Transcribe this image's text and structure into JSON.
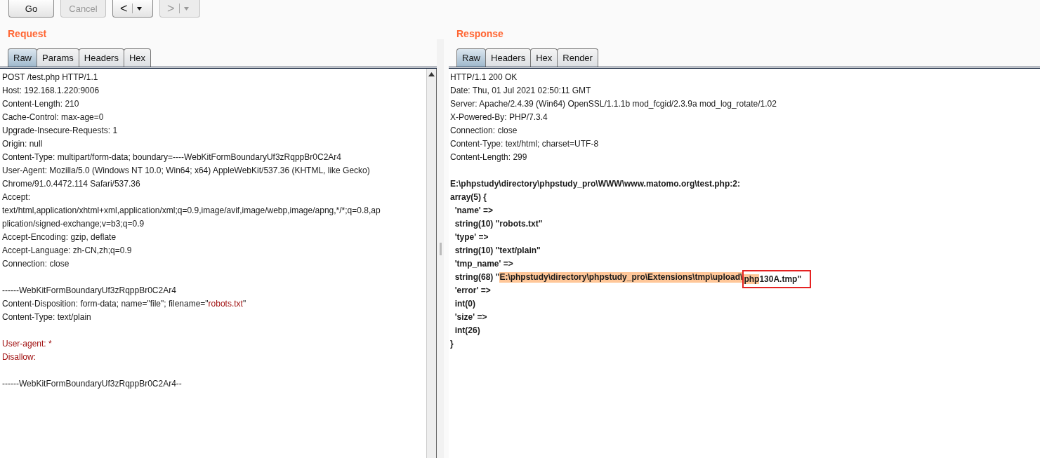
{
  "toolbar": {
    "buttons": [
      {
        "kind": "text",
        "label": "Go",
        "disabled": false
      },
      {
        "kind": "text",
        "label": "Cancel",
        "disabled": true
      },
      {
        "kind": "back",
        "label": "<",
        "disabled": false
      },
      {
        "kind": "forward",
        "label": ">",
        "disabled": true
      }
    ]
  },
  "request": {
    "title": "Request",
    "tabs": [
      {
        "label": "Raw",
        "selected": true
      },
      {
        "label": "Params",
        "selected": false
      },
      {
        "label": "Headers",
        "selected": false
      },
      {
        "label": "Hex",
        "selected": false
      }
    ],
    "lines": [
      {
        "kind": "plain",
        "text": "POST /test.php HTTP/1.1"
      },
      {
        "kind": "plain",
        "text": "Host: 192.168.1.220:9006"
      },
      {
        "kind": "plain",
        "text": "Content-Length: 210"
      },
      {
        "kind": "plain",
        "text": "Cache-Control: max-age=0"
      },
      {
        "kind": "plain",
        "text": "Upgrade-Insecure-Requests: 1"
      },
      {
        "kind": "plain",
        "text": "Origin: null"
      },
      {
        "kind": "plain",
        "text": "Content-Type: multipart/form-data; boundary=----WebKitFormBoundaryUf3zRqppBr0C2Ar4"
      },
      {
        "kind": "plain",
        "text": "User-Agent: Mozilla/5.0 (Windows NT 10.0; Win64; x64) AppleWebKit/537.36 (KHTML, like Gecko)"
      },
      {
        "kind": "plain",
        "text": "Chrome/91.0.4472.114 Safari/537.36"
      },
      {
        "kind": "plain",
        "text": "Accept:"
      },
      {
        "kind": "plain",
        "text": "text/html,application/xhtml+xml,application/xml;q=0.9,image/avif,image/webp,image/apng,*/*;q=0.8,ap"
      },
      {
        "kind": "plain",
        "text": "plication/signed-exchange;v=b3;q=0.9"
      },
      {
        "kind": "plain",
        "text": "Accept-Encoding: gzip, deflate"
      },
      {
        "kind": "plain",
        "text": "Accept-Language: zh-CN,zh;q=0.9"
      },
      {
        "kind": "plain",
        "text": "Connection: close"
      },
      {
        "kind": "blank"
      },
      {
        "kind": "plain",
        "text": "------WebKitFormBoundaryUf3zRqppBr0C2Ar4"
      },
      {
        "kind": "param",
        "before": "Content-Disposition: form-data; name=\"file\"; filename=\"",
        "value": "robots.txt",
        "after": "\""
      },
      {
        "kind": "plain",
        "text": "Content-Type: text/plain"
      },
      {
        "kind": "blank"
      },
      {
        "kind": "body",
        "text": "User-agent: *"
      },
      {
        "kind": "body",
        "text": "Disallow:"
      },
      {
        "kind": "blank"
      },
      {
        "kind": "plain",
        "text": "------WebKitFormBoundaryUf3zRqppBr0C2Ar4--"
      }
    ]
  },
  "response": {
    "title": "Response",
    "tabs": [
      {
        "label": "Raw",
        "selected": true
      },
      {
        "label": "Headers",
        "selected": false
      },
      {
        "label": "Hex",
        "selected": false
      },
      {
        "label": "Render",
        "selected": false
      }
    ],
    "lines": [
      {
        "kind": "plain",
        "text": "HTTP/1.1 200 OK"
      },
      {
        "kind": "plain",
        "text": "Date: Thu, 01 Jul 2021 02:50:11 GMT"
      },
      {
        "kind": "plain",
        "text": "Server: Apache/2.4.39 (Win64) OpenSSL/1.1.1b mod_fcgid/2.3.9a mod_log_rotate/1.02"
      },
      {
        "kind": "plain",
        "text": "X-Powered-By: PHP/7.3.4"
      },
      {
        "kind": "plain",
        "text": "Connection: close"
      },
      {
        "kind": "plain",
        "text": "Content-Type: text/html; charset=UTF-8"
      },
      {
        "kind": "plain",
        "text": "Content-Length: 299"
      },
      {
        "kind": "blank"
      },
      {
        "kind": "dump",
        "text": "E:\\phpstudy\\directory\\phpstudy_pro\\WWW\\www.matomo.org\\test.php:2:"
      },
      {
        "kind": "dump",
        "text": "array(5) {"
      },
      {
        "kind": "dump",
        "text": "  'name' =>"
      },
      {
        "kind": "dump",
        "text": "  string(10) \"robots.txt\""
      },
      {
        "kind": "dump",
        "text": "  'type' =>"
      },
      {
        "kind": "dump",
        "text": "  string(10) \"text/plain\""
      },
      {
        "kind": "dump",
        "text": "  'tmp_name' =>"
      },
      {
        "kind": "annotated",
        "before": "  string(68) \"",
        "highlighted": "E:\\phpstudy\\directory\\phpstudy_pro\\Extensions\\tmp\\upload\\",
        "boxed_highlighted": "php",
        "boxed": "130A.tmp\""
      },
      {
        "kind": "dump",
        "text": "  'error' =>"
      },
      {
        "kind": "dump",
        "text": "  int(0)"
      },
      {
        "kind": "dump",
        "text": "  'size' =>"
      },
      {
        "kind": "dump",
        "text": "  int(26)"
      },
      {
        "kind": "dump",
        "text": "}"
      }
    ]
  }
}
